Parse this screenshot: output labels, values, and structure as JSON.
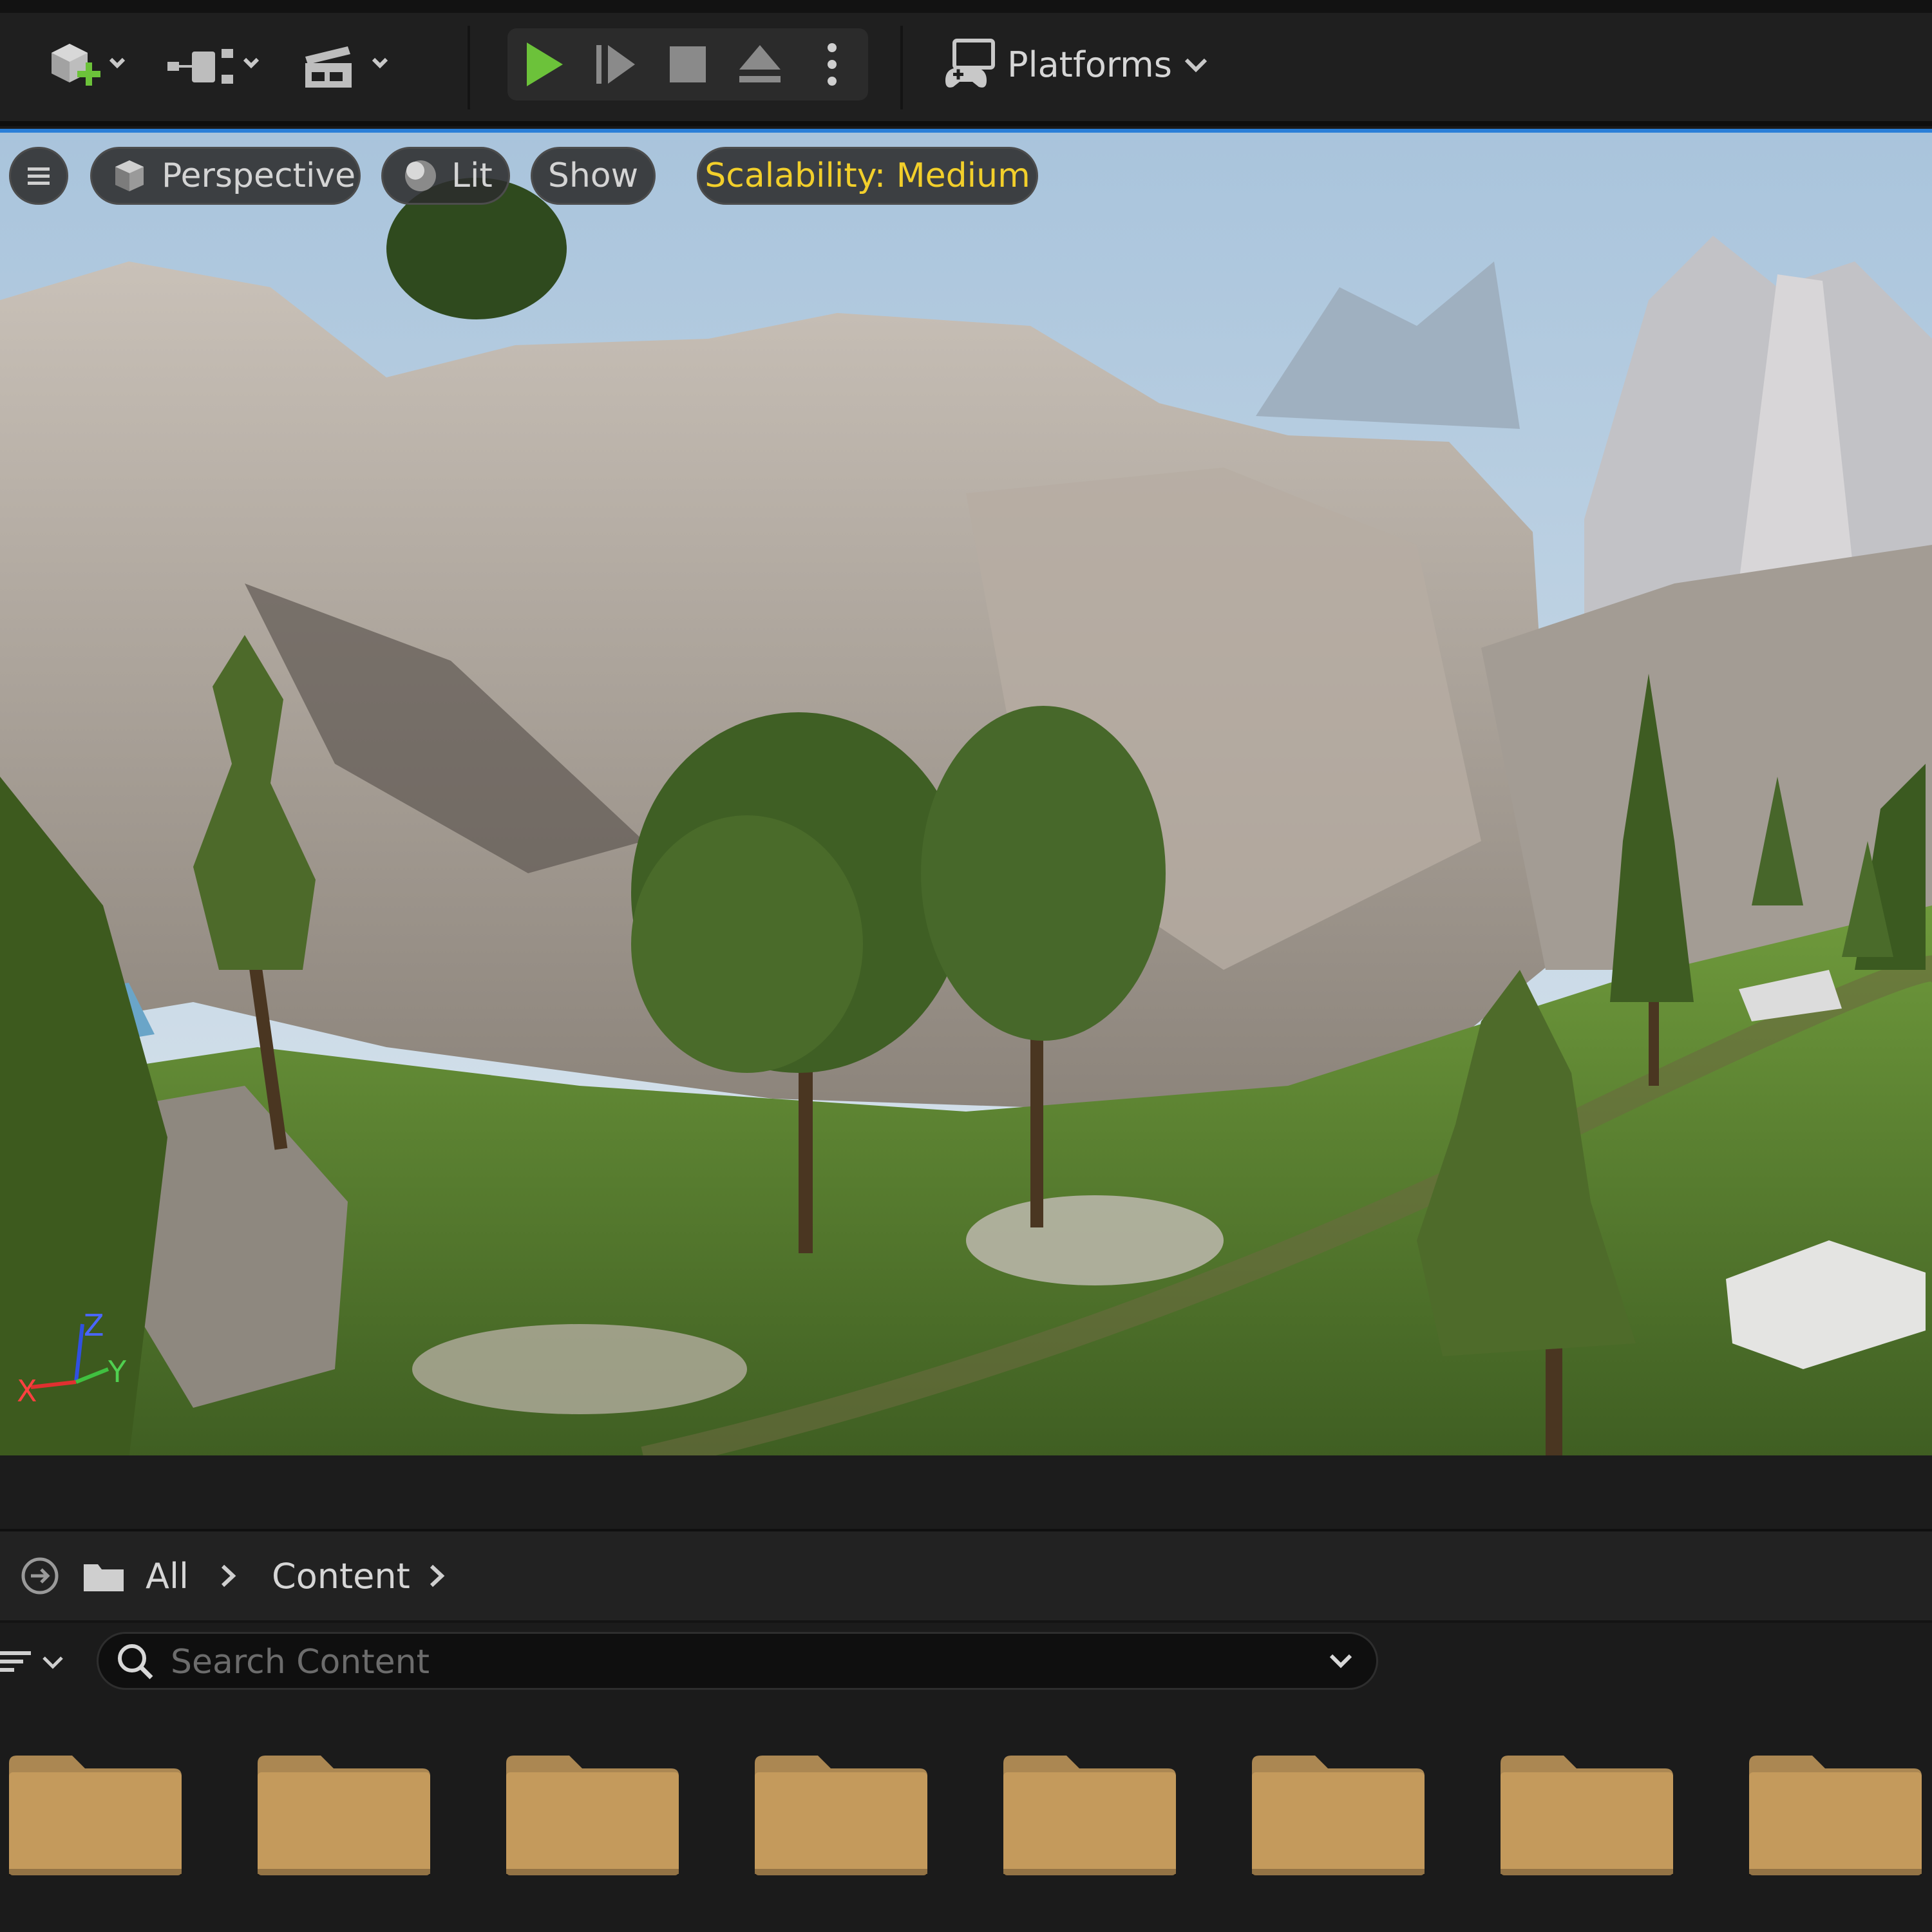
{
  "toolbar": {
    "quick_add_icon": "quick-add-cube-plus-icon",
    "blueprint_icon": "blueprint-graph-icon",
    "cinematics_icon": "clapperboard-icon",
    "play_icon": "play-icon",
    "advance_frame_icon": "advance-frame-icon",
    "stop_icon": "stop-icon",
    "eject_icon": "eject-icon",
    "more_icon": "vertical-ellipsis-icon",
    "platforms_label": "Platforms",
    "play_color": "#6cc23a"
  },
  "viewport": {
    "menu_icon": "hamburger-icon",
    "perspective_label": "Perspective",
    "lit_label": "Lit",
    "show_label": "Show",
    "scalability_label": "Scalability: Medium",
    "scalability_color": "#f2cf2b",
    "selection_accent": "#2a7fd8",
    "axis": {
      "x_label": "X",
      "y_label": "Y",
      "z_label": "Z"
    }
  },
  "content_browser": {
    "breadcrumb": [
      "All",
      "Content"
    ],
    "search_placeholder": "Search Content",
    "folder_count": 8,
    "folder_color": "#c49a5c"
  }
}
